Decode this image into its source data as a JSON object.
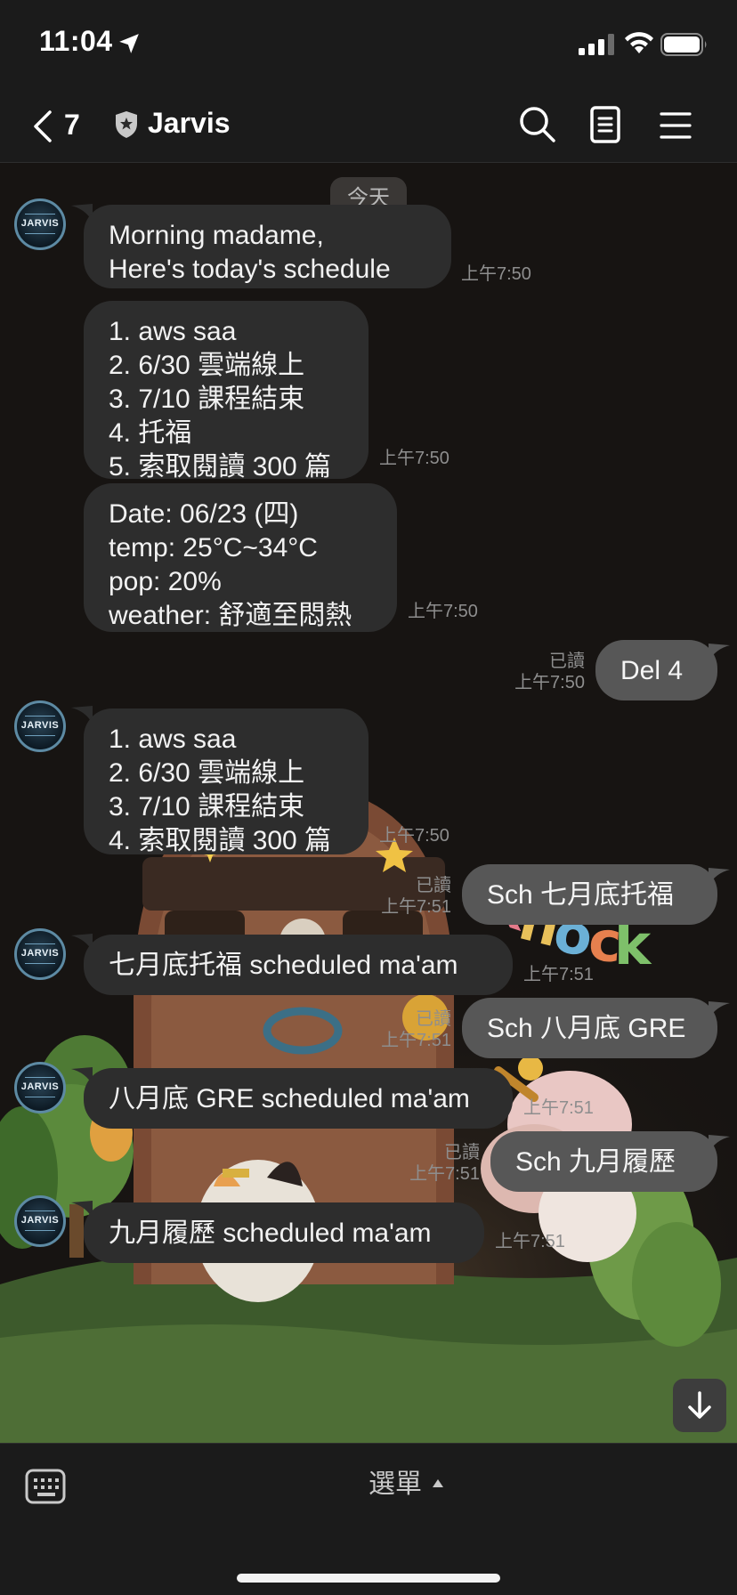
{
  "status_bar": {
    "time": "11:04"
  },
  "nav": {
    "back_count": "7",
    "title": "Jarvis"
  },
  "chat": {
    "date_label": "今天",
    "avatar_text": "JARVIS",
    "messages": [
      {
        "from": "bot",
        "text": "Morning madame,\nHere's today's schedule",
        "time": "上午7:50"
      },
      {
        "from": "bot",
        "text": "1. aws saa\n2. 6/30 雲端線上\n3. 7/10 課程結束\n4. 托福\n5. 索取閱讀 300 篇",
        "time": "上午7:50"
      },
      {
        "from": "bot",
        "text": "Date: 06/23 (四)\ntemp: 25°C~34°C\npop: 20%\nweather: 舒適至悶熱",
        "time": "上午7:50"
      },
      {
        "from": "me",
        "text": "Del 4",
        "read": "已讀",
        "time": "上午7:50"
      },
      {
        "from": "bot",
        "text": "1. aws saa\n2. 6/30 雲端線上\n3. 7/10 課程結束\n4. 索取閱讀 300 篇",
        "time": "上午7:50"
      },
      {
        "from": "me",
        "text": "Sch 七月底托福",
        "read": "已讀",
        "time": "上午7:51"
      },
      {
        "from": "bot",
        "text": "七月底托福 scheduled ma'am",
        "time": "上午7:51"
      },
      {
        "from": "me",
        "text": "Sch 八月底 GRE",
        "read": "已讀",
        "time": "上午7:51"
      },
      {
        "from": "bot",
        "text": "八月底 GRE scheduled ma'am",
        "time": "上午7:51"
      },
      {
        "from": "me",
        "text": "Sch 九月履歷",
        "read": "已讀",
        "time": "上午7:51"
      },
      {
        "from": "bot",
        "text": "九月履歷 scheduled ma'am",
        "time": "上午7:51"
      }
    ],
    "background_text": "knock"
  },
  "bottom": {
    "menu_label": "選單"
  },
  "colors": {
    "background": "#1b1b1b",
    "bubble_in": "#2d2d2d",
    "bubble_out": "#575757",
    "meta_text": "#8e8e8e"
  },
  "icons": [
    "location-arrow-icon",
    "signal-icon",
    "wifi-icon",
    "battery-icon",
    "back-chevron-icon",
    "shield-icon",
    "search-icon",
    "notes-icon",
    "menu-icon",
    "scroll-down-icon",
    "keyboard-icon"
  ]
}
